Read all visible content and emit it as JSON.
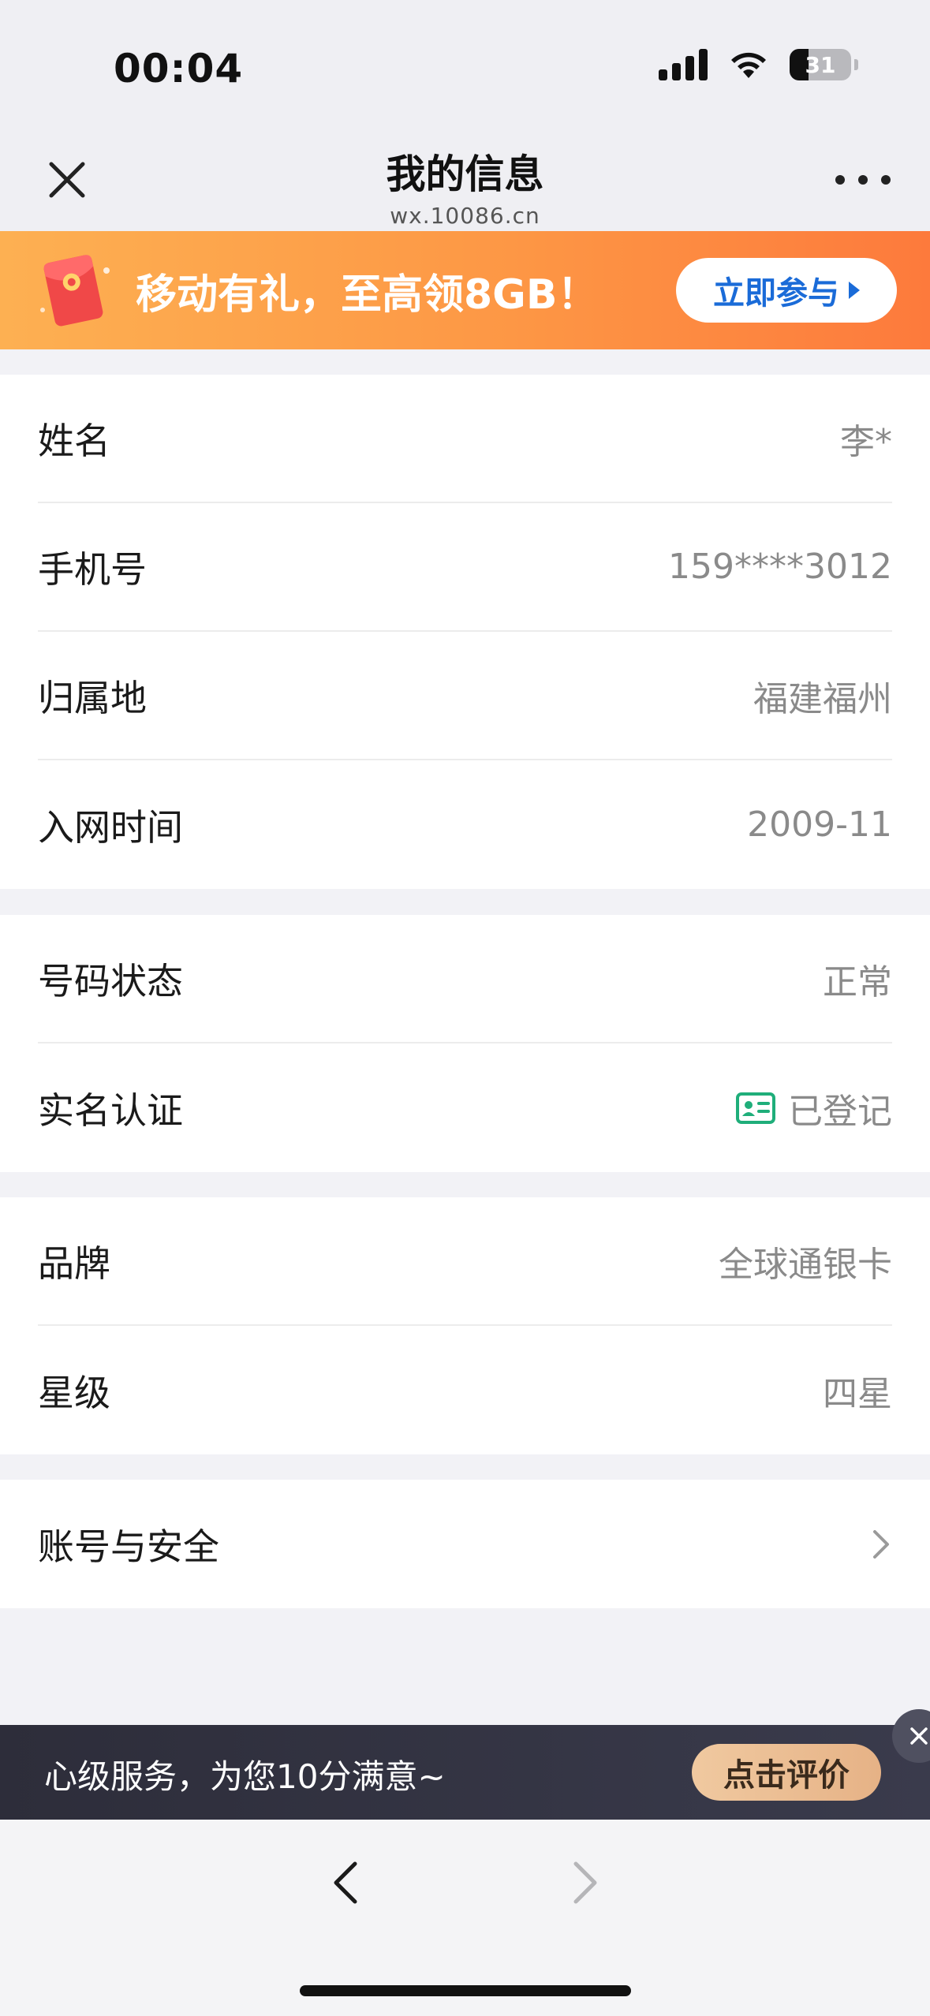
{
  "status_bar": {
    "time": "00:04",
    "battery": "31",
    "icons": [
      "signal-icon",
      "wifi-icon",
      "battery-icon"
    ]
  },
  "nav": {
    "title": "我的信息",
    "subtitle": "wx.10086.cn",
    "close_icon": "close-icon",
    "more_icon": "more-icon"
  },
  "promo": {
    "text": "移动有礼，至高领8GB！",
    "button_label": "立即参与",
    "icon": "red-envelope-icon"
  },
  "sections": {
    "basic": {
      "rows": [
        {
          "label": "姓名",
          "value": "李*"
        },
        {
          "label": "手机号",
          "value": "159****3012"
        },
        {
          "label": "归属地",
          "value": "福建福州"
        },
        {
          "label": "入网时间",
          "value": "2009-11"
        }
      ]
    },
    "status": {
      "rows": [
        {
          "label": "号码状态",
          "value": "正常"
        },
        {
          "label": "实名认证",
          "value": "已登记",
          "icon": "id-card-icon"
        }
      ]
    },
    "brand": {
      "rows": [
        {
          "label": "品牌",
          "value": "全球通银卡"
        },
        {
          "label": "星级",
          "value": "四星"
        }
      ]
    },
    "account": {
      "label": "账号与安全"
    }
  },
  "rating": {
    "text": "心级服务，为您10分满意~",
    "button_label": "点击评价"
  },
  "colors": {
    "promo_start": "#fdb052",
    "promo_end": "#fd7a3c",
    "accent_blue": "#1a6bd8",
    "id_green": "#1fae7a"
  }
}
